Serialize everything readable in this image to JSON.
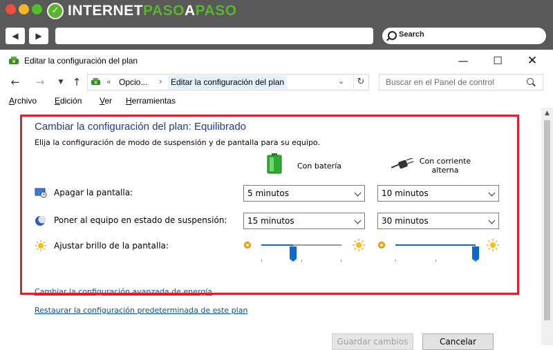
{
  "brand": {
    "name_part1": "INTERNET",
    "name_part2": "PASO",
    "name_part3": "A",
    "name_part4": "PASO"
  },
  "browser": {
    "search_label": "Search"
  },
  "window": {
    "title": "Editar la configuración del plan",
    "controls": {
      "minimize": "—",
      "maximize": "☐",
      "close": "✕"
    }
  },
  "address_bar": {
    "prefix": "«",
    "crumb1": "Opcio...",
    "crumb2": "Editar la configuración del plan",
    "search_placeholder": "Buscar en el Panel de control"
  },
  "menu": [
    "Archivo",
    "Edición",
    "Ver",
    "Herramientas"
  ],
  "plan": {
    "title": "Cambiar la configuración del plan: Equilibrado",
    "description": "Elija la configuración de modo de suspensión y de pantalla para su equipo.",
    "columns": {
      "battery": "Con batería",
      "plugged_line1": "Con corriente",
      "plugged_line2": "alterna"
    },
    "rows": {
      "display": {
        "label": "Apagar la pantalla:",
        "battery": "5 minutos",
        "plugged": "10 minutos"
      },
      "sleep": {
        "label": "Poner al equipo en estado de suspensión:",
        "battery": "15 minutos",
        "plugged": "30 minutos"
      },
      "brightness": {
        "label": "Ajustar brillo de la pantalla:",
        "battery_level": 0.4,
        "plugged_level": 1.0
      }
    },
    "advanced_link": "Cambiar la configuración avanzada de energía",
    "restore_link": "Restaurar la configuración predeterminada de este plan"
  },
  "buttons": {
    "save": "Guardar cambios",
    "cancel": "Cancelar"
  },
  "colors": {
    "highlight": "#e3202a",
    "title_blue": "#1e3a96",
    "link_blue": "#0058a3",
    "slider_blue": "#0b6bc9"
  }
}
